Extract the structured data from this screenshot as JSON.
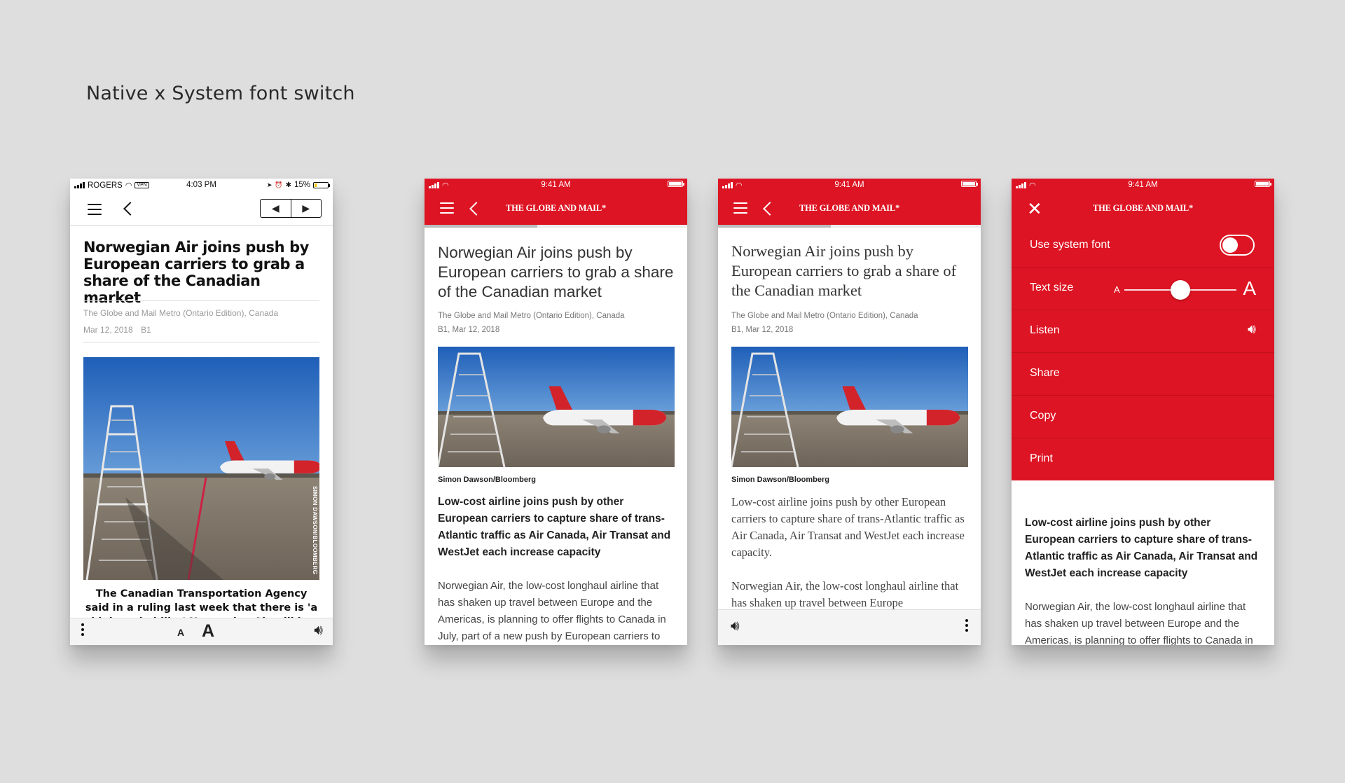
{
  "page": {
    "title": "Native x System font switch"
  },
  "colors": {
    "brand_red": "#dd1423",
    "background": "#dedede"
  },
  "phone1": {
    "status": {
      "carrier": "ROGERS",
      "vpn": "VPN",
      "time": "4:03 PM",
      "battery": "15%",
      "battery_level": 0.15
    },
    "headline": "Norwegian Air joins push by European carriers to grab a share of the Canadian market",
    "source": "The Globe and Mail Metro (Ontario Edition), Canada",
    "date": "Mar 12, 2018",
    "page_ref": "B1",
    "photo_credit": "SIMON DAWSON/BLOOMBERG",
    "body": "The Canadian Transportation Agency said in a ruling last week that there is 'a high probability' Norwegian Air will be issued a licence in time for",
    "font_small": "A",
    "font_large": "A"
  },
  "phone2": {
    "status": {
      "time": "9:41 AM"
    },
    "masthead": "THE GLOBE AND MAIL*",
    "reading_progress": 0.43,
    "headline": "Norwegian Air joins push by European carriers to grab a share of the Canadian market",
    "source": "The Globe and Mail Metro (Ontario Edition), Canada",
    "date_line": "B1, Mar 12, 2018",
    "caption": "Simon Dawson/Bloomberg",
    "dek": "Low-cost airline joins push by other European carriers to capture share of trans-Atlantic traffic as Air Canada, Air Transat and WestJet each increase capacity",
    "body": "Norwegian Air, the low-cost longhaul airline that has shaken up travel between Europe and the Americas, is planning to offer flights to Canada in July, part of a new push by European carriers to"
  },
  "phone3": {
    "status": {
      "time": "9:41 AM"
    },
    "masthead": "THE GLOBE AND MAIL*",
    "reading_progress": 0.43,
    "headline": "Norwegian Air joins push by European carriers to grab a share of the Canadian market",
    "source": "The Globe and Mail Metro (Ontario Edition), Canada",
    "date_line": "B1, Mar 12, 2018",
    "caption": "Simon Dawson/Bloomberg",
    "dek": "Low-cost airline joins push by other European carriers to capture share of trans-Atlantic traffic as Air Canada, Air Transat and WestJet each increase capacity.",
    "body": "Norwegian Air, the low-cost longhaul airline that has shaken up travel between Europe"
  },
  "phone4": {
    "status": {
      "time": "9:41 AM"
    },
    "masthead": "THE GLOBE AND MAIL*",
    "menu": {
      "use_system_font": "Use system font",
      "system_font_on": false,
      "text_size": "Text size",
      "text_size_small": "A",
      "text_size_large": "A",
      "text_size_level": 0.5,
      "listen": "Listen",
      "share": "Share",
      "copy": "Copy",
      "print": "Print"
    },
    "dek": "Low-cost airline joins push by other European carriers to capture share of trans-Atlantic traffic as Air Canada, Air Transat and WestJet each increase capacity",
    "body": "Norwegian Air, the low-cost longhaul airline that has shaken up travel between Europe and the Americas, is planning to offer flights to Canada in"
  }
}
